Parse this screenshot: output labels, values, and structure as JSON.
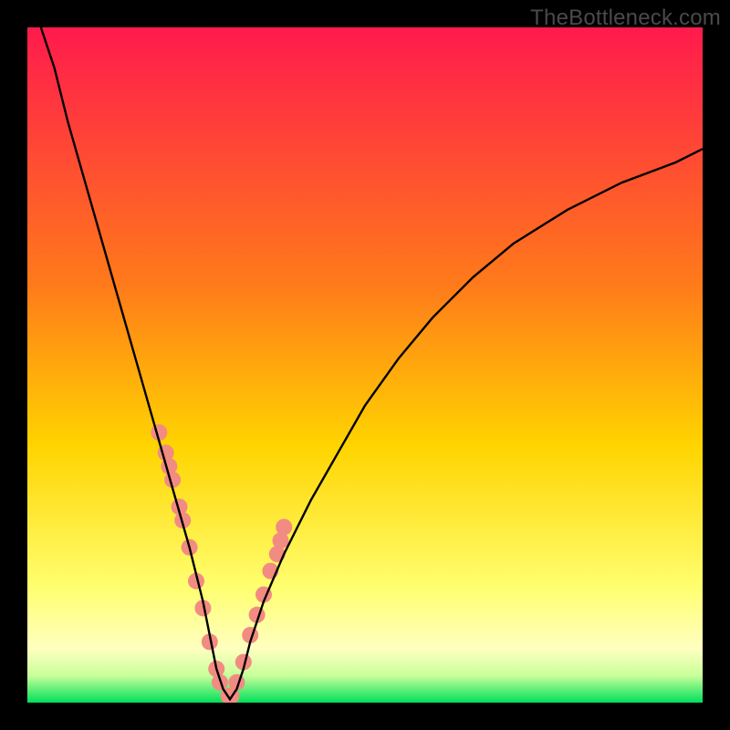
{
  "watermark": "TheBottleneck.com",
  "chart_data": {
    "type": "line",
    "title": "",
    "xlabel": "",
    "ylabel": "",
    "xlim": [
      0,
      100
    ],
    "ylim": [
      0,
      100
    ],
    "grid": false,
    "background_gradient": {
      "top_color": "#ff1a4d",
      "mid_color": "#ffd400",
      "lower_color": "#ffff9e",
      "bottom_color": "#00e05a"
    },
    "curve": {
      "x": [
        2,
        4,
        6,
        8,
        10,
        12,
        14,
        16,
        18,
        20,
        22,
        24,
        26,
        27,
        28,
        29,
        30,
        31,
        32,
        33,
        35,
        38,
        42,
        46,
        50,
        55,
        60,
        66,
        72,
        80,
        88,
        96,
        100
      ],
      "y": [
        100,
        94,
        86,
        79,
        72,
        65,
        58,
        51,
        44,
        37,
        30,
        23,
        15,
        10,
        5,
        2,
        0.5,
        2,
        5,
        9,
        15,
        22,
        30,
        37,
        44,
        51,
        57,
        63,
        68,
        73,
        77,
        80,
        82
      ]
    },
    "scatter_points": {
      "x": [
        19.5,
        20.5,
        21,
        21.5,
        22.5,
        23,
        24,
        25,
        26,
        27,
        28,
        28.5,
        29.8,
        30.2,
        31,
        32,
        33,
        34,
        35,
        36,
        37,
        37.5,
        38
      ],
      "y": [
        40,
        37,
        35,
        33,
        29,
        27,
        23,
        18,
        14,
        9,
        5,
        3,
        1,
        1,
        3,
        6,
        10,
        13,
        16,
        19.5,
        22,
        24,
        26
      ],
      "color": "#f28b82",
      "radius": 9
    },
    "line_color": "#000000",
    "line_width": 2.4
  }
}
